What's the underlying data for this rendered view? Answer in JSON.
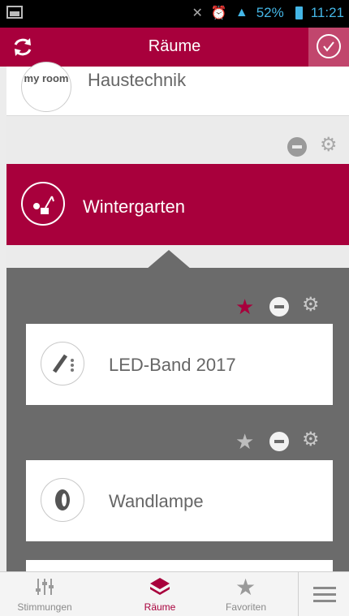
{
  "status_bar": {
    "battery": "52%",
    "time": "11:21"
  },
  "app_bar": {
    "title": "Räume"
  },
  "rooms": [
    {
      "label": "Haustechnik",
      "logo_text": "my room"
    },
    {
      "label": "Wintergarten"
    }
  ],
  "devices": [
    {
      "label": "LED-Band 2017",
      "favorite": true
    },
    {
      "label": "Wandlampe",
      "favorite": false
    }
  ],
  "bottom_nav": {
    "items": [
      {
        "label": "Stimmungen",
        "icon": "sliders-icon"
      },
      {
        "label": "Räume",
        "icon": "rooms-icon",
        "active": true
      },
      {
        "label": "Favoriten",
        "icon": "star-icon"
      }
    ]
  },
  "colors": {
    "brand": "#a8003c",
    "panel": "#6b6b6b",
    "favorite_active": "#a8003c",
    "favorite_inactive": "#bdbdbd"
  }
}
